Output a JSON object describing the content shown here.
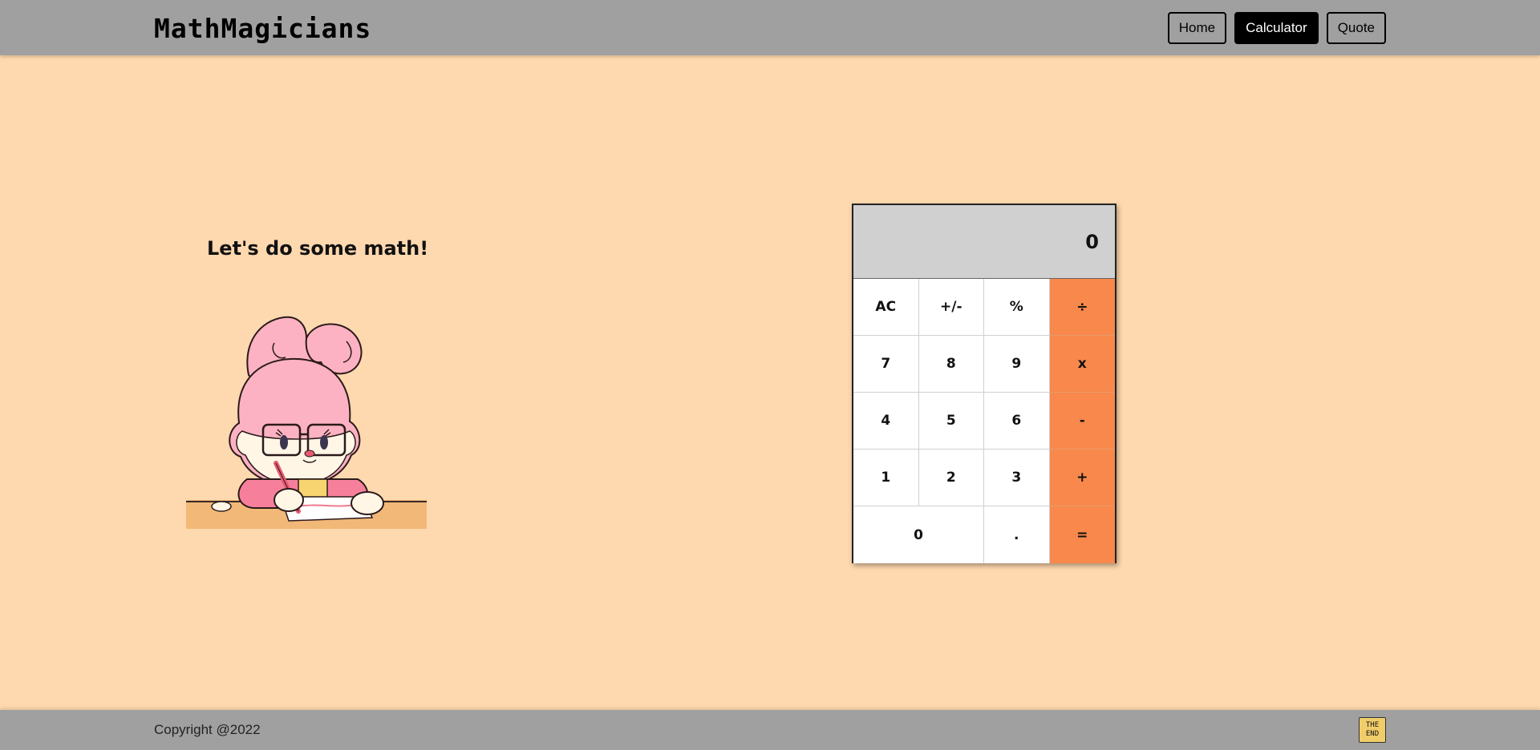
{
  "header": {
    "logo": "MathMagicians",
    "nav": [
      {
        "label": "Home",
        "active": false
      },
      {
        "label": "Calculator",
        "active": true
      },
      {
        "label": "Quote",
        "active": false
      }
    ]
  },
  "main": {
    "heading": "Let's do some math!",
    "illustration": "bunny-writing-illustration"
  },
  "calculator": {
    "display": "0",
    "keys": {
      "ac": "AC",
      "sign": "+/-",
      "percent": "%",
      "divide": "÷",
      "seven": "7",
      "eight": "8",
      "nine": "9",
      "multiply": "x",
      "four": "4",
      "five": "5",
      "six": "6",
      "minus": "-",
      "one": "1",
      "two": "2",
      "three": "3",
      "plus": "+",
      "zero": "0",
      "dot": ".",
      "equals": "="
    }
  },
  "footer": {
    "copyright": "Copyright @2022",
    "badge_line1": "THE",
    "badge_line2": "END"
  },
  "colors": {
    "background": "#fed8ae",
    "header": "#a0a0a0",
    "operator": "#f8884b",
    "display": "#d0d0d0"
  }
}
